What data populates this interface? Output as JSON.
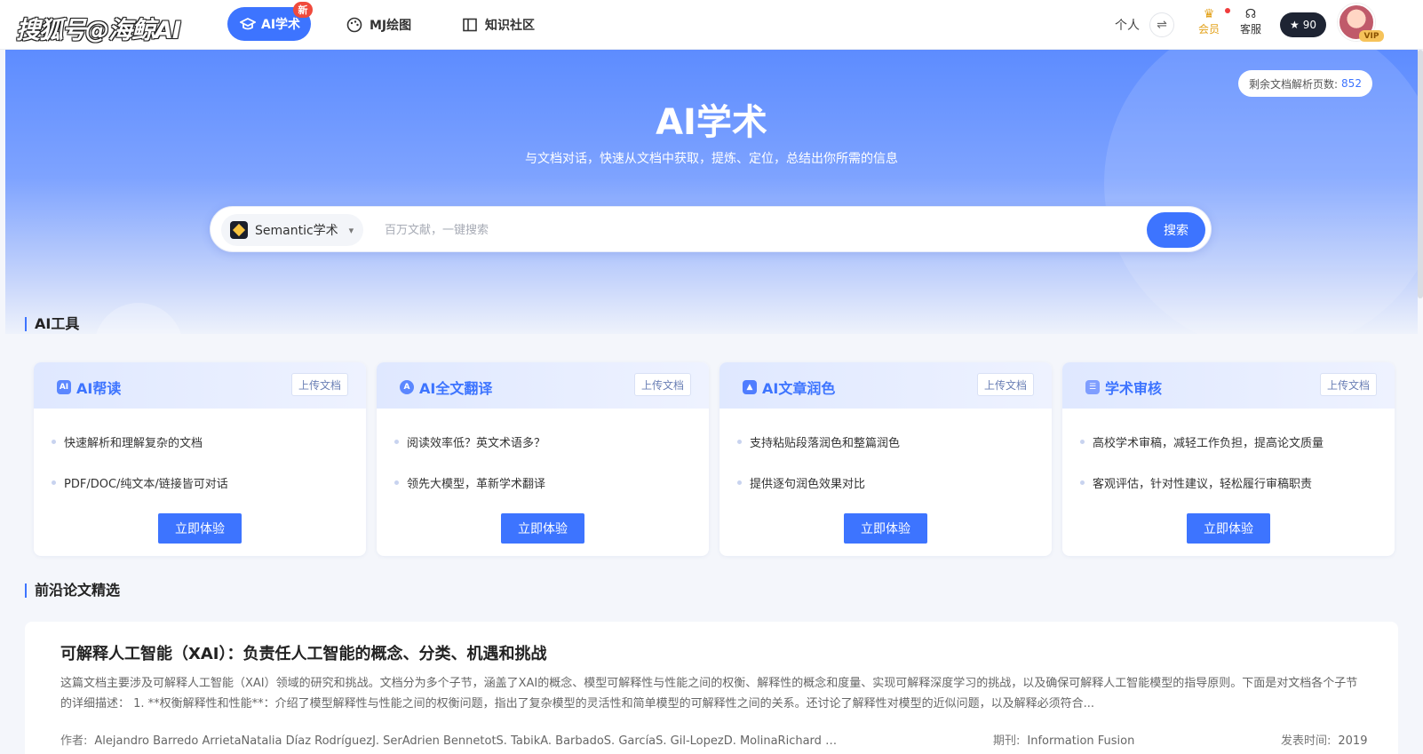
{
  "watermark": "搜狐号@海鲸AI",
  "nav": {
    "active": "AI学术",
    "new_badge": "新",
    "items": [
      "MJ绘图",
      "知识社区"
    ]
  },
  "user": {
    "personal": "个人",
    "member": "会员",
    "service": "客服",
    "points": "90",
    "vip": "VIP"
  },
  "hero": {
    "remaining_label": "剩余文档解析页数:",
    "remaining_value": "852",
    "title": "AI学术",
    "subtitle": "与文档对话，快速从文档中获取，提炼、定位，总结出你所需的信息"
  },
  "search": {
    "source": "Semantic学术",
    "placeholder": "百万文献，一键搜索",
    "button": "搜索"
  },
  "tools": {
    "title": "AI工具",
    "upload_label": "上传文档",
    "try_label": "立即体验",
    "cards": [
      {
        "title": "AI帮读",
        "icon": "book-icon",
        "features": [
          "快速解析和理解复杂的文档",
          "PDF/DOC/纯文本/链接皆可对话"
        ]
      },
      {
        "title": "AI全文翻译",
        "icon": "translate-icon",
        "features": [
          "阅读效率低？英文术语多？",
          "领先大模型，革新学术翻译"
        ]
      },
      {
        "title": "AI文章润色",
        "icon": "graduation-cap-icon",
        "features": [
          "支持粘贴段落润色和整篇润色",
          "提供逐句润色效果对比"
        ]
      },
      {
        "title": "学术审核",
        "icon": "clipboard-icon",
        "features": [
          "高校学术审稿，减轻工作负担，提高论文质量",
          "客观评估，针对性建议，轻松履行审稿职责"
        ]
      }
    ]
  },
  "papers": {
    "title": "前沿论文精选",
    "items": [
      {
        "title": "可解释人工智能（XAI）：负责任人工智能的概念、分类、机遇和挑战",
        "abstract": "这篇文档主要涉及可解释人工智能（XAI）领域的研究和挑战。文档分为多个子节，涵盖了XAI的概念、模型可解释性与性能之间的权衡、解释性的概念和度量、实现可解释深度学习的挑战，以及确保可解释人工智能模型的指导原则。下面是对文档各个子节的详细描述： 1. **权衡解释性和性能**：介绍了模型解释性与性能之间的权衡问题，指出了复杂模型的灵活性和简单模型的可解释性之间的关系。还讨论了解释性对模型的近似问题，以及解释必须符合...",
        "author_label": "作者:",
        "authors": "Alejandro Barredo ArrietaNatalia Díaz RodríguezJ. SerAdrien BennetotS. TabikA. BarbadoS. GarcíaS. Gil-LopezD. MolinaRichard B...",
        "journal_label": "期刊:",
        "journal": "Information Fusion",
        "date_label": "发表时间:",
        "date": "2019"
      }
    ]
  },
  "colors": {
    "accent": "#3d74ff",
    "hero_top": "#5d8cff",
    "new_badge": "#f04a3c"
  }
}
